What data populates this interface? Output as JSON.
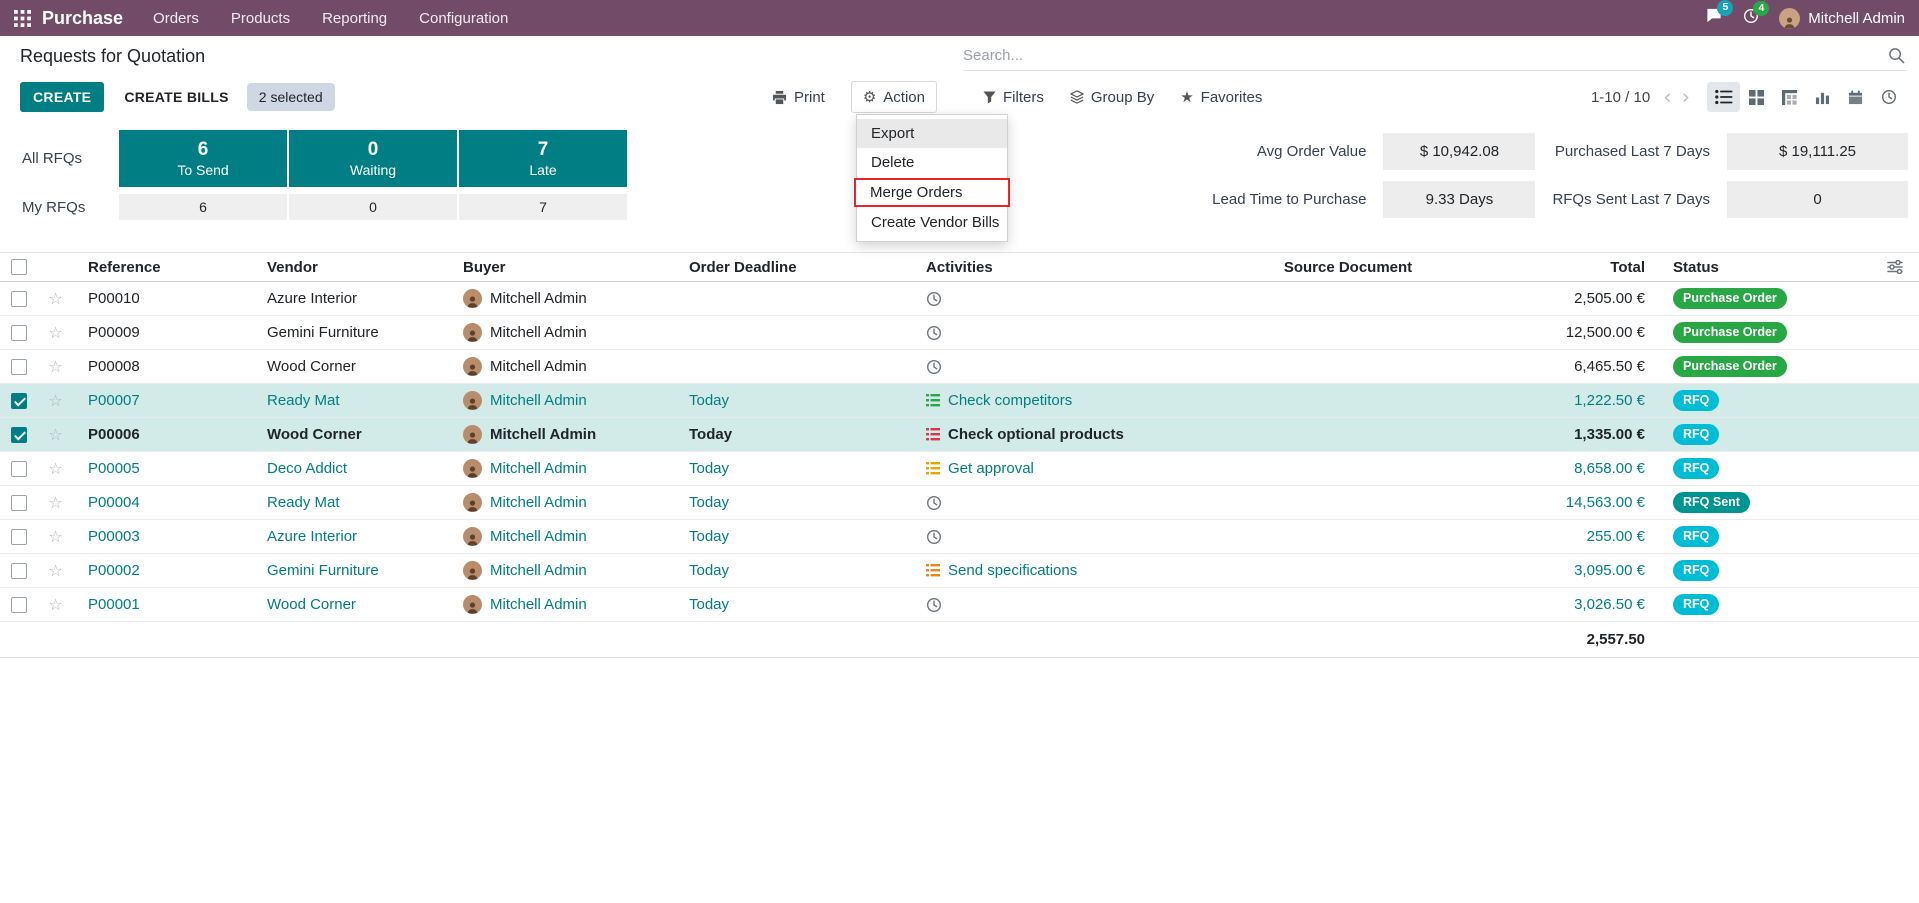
{
  "topbar": {
    "app_name": "Purchase",
    "menus": [
      "Orders",
      "Products",
      "Reporting",
      "Configuration"
    ],
    "messages_badge": "5",
    "activities_badge": "4",
    "user_name": "Mitchell Admin"
  },
  "breadcrumb": {
    "title": "Requests for Quotation"
  },
  "search": {
    "placeholder": "Search..."
  },
  "control": {
    "create_label": "CREATE",
    "create_bills_label": "CREATE BILLS",
    "selected_label": "2 selected",
    "print_label": "Print",
    "action_label": "Action",
    "filters_label": "Filters",
    "group_by_label": "Group By",
    "favorites_label": "Favorites",
    "pager": "1-10 / 10"
  },
  "action_menu": {
    "items": [
      {
        "label": "Export",
        "state": "hover"
      },
      {
        "label": "Delete",
        "state": ""
      },
      {
        "label": "Merge Orders",
        "state": "outlined"
      },
      {
        "label": "Create Vendor Bills",
        "state": ""
      }
    ]
  },
  "view_switcher": {
    "active": "list",
    "views": [
      "list",
      "kanban",
      "pivot",
      "graph",
      "calendar",
      "activity"
    ]
  },
  "dashboard": {
    "all_rfqs": {
      "label": "All RFQs",
      "boxes": [
        {
          "count": "6",
          "sub": "To Send"
        },
        {
          "count": "0",
          "sub": "Waiting"
        },
        {
          "count": "7",
          "sub": "Late"
        }
      ]
    },
    "my_rfqs": {
      "label": "My RFQs",
      "values": [
        "6",
        "0",
        "7"
      ]
    },
    "kpis": [
      {
        "label": "Avg Order Value",
        "value": "$ 10,942.08"
      },
      {
        "label": "Purchased Last 7 Days",
        "value": "$ 19,111.25"
      },
      {
        "label": "Lead Time to Purchase",
        "value": "9.33 Days"
      },
      {
        "label": "RFQs Sent Last 7 Days",
        "value": "0"
      }
    ]
  },
  "colors": {
    "topbar": "#714B67",
    "primary": "#017E84",
    "selected_row": "#d2eae8",
    "annotation": "#e5252a",
    "status": {
      "Purchase Order": "#28a745",
      "RFQ": "#00bcd4",
      "RFQ Sent": "#00968f"
    }
  },
  "table": {
    "columns": [
      "Reference",
      "Vendor",
      "Buyer",
      "Order Deadline",
      "Activities",
      "Source Document",
      "Total",
      "Status"
    ],
    "rows": [
      {
        "reference": "P00010",
        "vendor": "Azure Interior",
        "buyer": "Mitchell Admin",
        "deadline": "",
        "activity": {
          "icon": "clock"
        },
        "source": "",
        "total": "2,505.00 €",
        "status": "Purchase Order",
        "checked": false,
        "style": "normal"
      },
      {
        "reference": "P00009",
        "vendor": "Gemini Furniture",
        "buyer": "Mitchell Admin",
        "deadline": "",
        "activity": {
          "icon": "clock"
        },
        "source": "",
        "total": "12,500.00 €",
        "status": "Purchase Order",
        "checked": false,
        "style": "normal"
      },
      {
        "reference": "P00008",
        "vendor": "Wood Corner",
        "buyer": "Mitchell Admin",
        "deadline": "",
        "activity": {
          "icon": "clock"
        },
        "source": "",
        "total": "6,465.50 €",
        "status": "Purchase Order",
        "checked": false,
        "style": "normal"
      },
      {
        "reference": "P00007",
        "vendor": "Ready Mat",
        "buyer": "Mitchell Admin",
        "deadline": "Today",
        "activity": {
          "icon": "list",
          "color": "#28a745",
          "text": "Check competitors"
        },
        "source": "",
        "total": "1,222.50 €",
        "status": "RFQ",
        "checked": true,
        "style": "link"
      },
      {
        "reference": "P00006",
        "vendor": "Wood Corner",
        "buyer": "Mitchell Admin",
        "deadline": "Today",
        "activity": {
          "icon": "list",
          "color": "#dc3545",
          "text": "Check optional products"
        },
        "source": "",
        "total": "1,335.00 €",
        "status": "RFQ",
        "checked": true,
        "style": "bold"
      },
      {
        "reference": "P00005",
        "vendor": "Deco Addict",
        "buyer": "Mitchell Admin",
        "deadline": "Today",
        "activity": {
          "icon": "list",
          "color": "#e4a900",
          "text": "Get approval"
        },
        "source": "",
        "total": "8,658.00 €",
        "status": "RFQ",
        "checked": false,
        "style": "link"
      },
      {
        "reference": "P00004",
        "vendor": "Ready Mat",
        "buyer": "Mitchell Admin",
        "deadline": "Today",
        "activity": {
          "icon": "clock"
        },
        "source": "",
        "total": "14,563.00 €",
        "status": "RFQ Sent",
        "checked": false,
        "style": "link"
      },
      {
        "reference": "P00003",
        "vendor": "Azure Interior",
        "buyer": "Mitchell Admin",
        "deadline": "Today",
        "activity": {
          "icon": "clock"
        },
        "source": "",
        "total": "255.00 €",
        "status": "RFQ",
        "checked": false,
        "style": "link"
      },
      {
        "reference": "P00002",
        "vendor": "Gemini Furniture",
        "buyer": "Mitchell Admin",
        "deadline": "Today",
        "activity": {
          "icon": "list",
          "color": "#e8871e",
          "text": "Send specifications"
        },
        "source": "",
        "total": "3,095.00 €",
        "status": "RFQ",
        "checked": false,
        "style": "link"
      },
      {
        "reference": "P00001",
        "vendor": "Wood Corner",
        "buyer": "Mitchell Admin",
        "deadline": "Today",
        "activity": {
          "icon": "clock"
        },
        "source": "",
        "total": "3,026.50 €",
        "status": "RFQ",
        "checked": false,
        "style": "link"
      }
    ],
    "footer_total": "2,557.50"
  }
}
